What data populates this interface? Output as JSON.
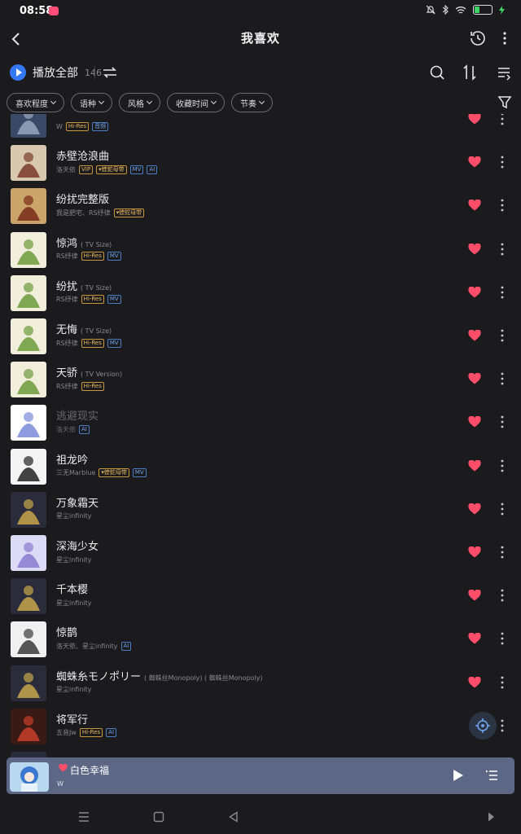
{
  "status": {
    "time": "08:58",
    "app_badge": ""
  },
  "header": {
    "title": "我喜欢"
  },
  "toolbar": {
    "play_all": "播放全部",
    "count": "146"
  },
  "filters": [
    "喜欢程度",
    "语种",
    "风格",
    "收藏时间",
    "节奏"
  ],
  "songs": [
    {
      "title": "",
      "sub": "",
      "artist": "W",
      "badges": [
        "Hi-Res",
        "音频"
      ],
      "cover": [
        "#3a4a66",
        "#9aa6c0"
      ],
      "dim": false,
      "partial": true
    },
    {
      "title": "赤壁沧浪曲",
      "sub": "",
      "artist": "洛天依",
      "badges": [
        "VIP",
        "蝰蛇母带",
        "MV",
        "AI"
      ],
      "cover": [
        "#d8c8b0",
        "#7a3a2a"
      ],
      "dim": false
    },
    {
      "title": "纷扰完整版",
      "sub": "",
      "artist": "我是肥宅、RS纾律",
      "badges": [
        "蝰蛇母带"
      ],
      "cover": [
        "#caa56a",
        "#7a2a1a"
      ],
      "dim": false
    },
    {
      "title": "惊鸿",
      "sub": "( TV Size)",
      "artist": "RS纾律",
      "badges": [
        "Hi-Res",
        "MV"
      ],
      "cover": [
        "#f2eedc",
        "#6c9a3a"
      ],
      "dim": false
    },
    {
      "title": "纷扰",
      "sub": "( TV Size)",
      "artist": "RS纾律",
      "badges": [
        "Hi-Res",
        "MV"
      ],
      "cover": [
        "#f2eedc",
        "#6c9a3a"
      ],
      "dim": false
    },
    {
      "title": "无悔",
      "sub": "( TV Size)",
      "artist": "RS纾律",
      "badges": [
        "Hi-Res",
        "MV"
      ],
      "cover": [
        "#f2eedc",
        "#6c9a3a"
      ],
      "dim": false
    },
    {
      "title": "天骄",
      "sub": "( TV Version)",
      "artist": "RS纾律",
      "badges": [
        "Hi-Res"
      ],
      "cover": [
        "#f2eedc",
        "#6c9a3a"
      ],
      "dim": false
    },
    {
      "title": "逃避现实",
      "sub": "",
      "artist": "洛天依",
      "badges": [
        "AI"
      ],
      "cover": [
        "#ffffff",
        "#7a8ad8"
      ],
      "dim": true
    },
    {
      "title": "祖龙吟",
      "sub": "",
      "artist": "三无Marblue",
      "badges": [
        "蝰蛇母带",
        "MV"
      ],
      "cover": [
        "#f4f4f4",
        "#222222"
      ],
      "dim": false
    },
    {
      "title": "万象霜天",
      "sub": "",
      "artist": "星尘infinity",
      "badges": [],
      "cover": [
        "#2a2c3c",
        "#c7a64a"
      ],
      "dim": false
    },
    {
      "title": "深海少女",
      "sub": "",
      "artist": "星尘infinity",
      "badges": [],
      "cover": [
        "#dcdaf4",
        "#8a7ad0"
      ],
      "dim": false
    },
    {
      "title": "千本樱",
      "sub": "",
      "artist": "星尘infinity",
      "badges": [],
      "cover": [
        "#2a2c3c",
        "#c7a64a"
      ],
      "dim": false
    },
    {
      "title": "惊鹊",
      "sub": "",
      "artist": "洛天依、星尘infinity",
      "badges": [
        "AI"
      ],
      "cover": [
        "#f0f0f0",
        "#3a3a3a"
      ],
      "dim": false
    },
    {
      "title": "蜘蛛糸モノポリー",
      "sub": "( 蜘蛛丝Monopoly)  ( 蜘蛛丝Monopoly)",
      "artist": "星尘infinity",
      "badges": [],
      "cover": [
        "#2a2c3c",
        "#c7a64a"
      ],
      "dim": false
    },
    {
      "title": "将军行",
      "sub": "",
      "artist": "五音Jw",
      "badges": [
        "Hi-Res",
        "AI"
      ],
      "cover": [
        "#3a1a14",
        "#c8402a"
      ],
      "dim": false,
      "locate": true
    },
    {
      "title": "",
      "sub": "",
      "artist": "",
      "badges": [],
      "cover": [
        "#2a2c3c",
        "#c7a64a"
      ],
      "dim": false,
      "partial": true
    }
  ],
  "player": {
    "title": "白色幸福",
    "artist": "W"
  },
  "colors": {
    "accent": "#3478f6",
    "heart": "#ff4d6a",
    "player_bg": "#5b6785"
  },
  "icons": [
    "back-icon",
    "history-icon",
    "more-icon",
    "shuffle-icon",
    "search-icon",
    "sort-icon",
    "list-icon",
    "filter-icon",
    "heart-icon",
    "locate-icon",
    "play-icon",
    "queue-icon"
  ]
}
